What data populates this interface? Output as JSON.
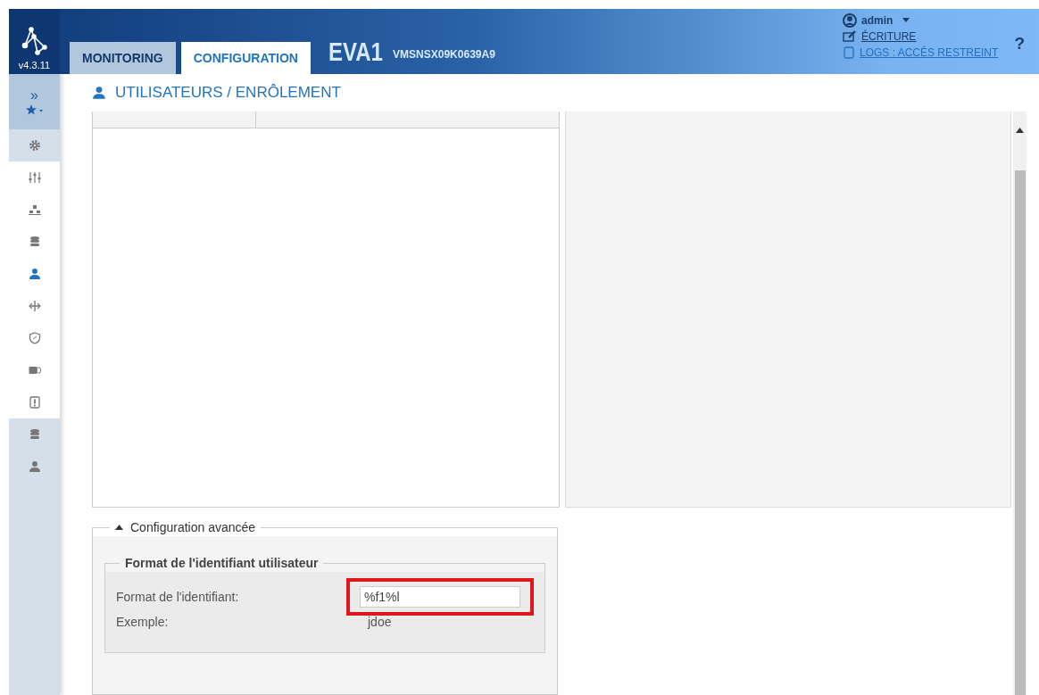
{
  "header": {
    "version": "v4.3.11",
    "device_name": "EVA1",
    "serial": "VMSNSX09K0639A9",
    "user": "admin",
    "mode_link": "ÉCRITURE",
    "logs_link": "LOGS : ACCÉS RESTREINT",
    "help": "?"
  },
  "tabs": [
    {
      "label": "MONITORING",
      "selected": false
    },
    {
      "label": "CONFIGURATION",
      "selected": true
    }
  ],
  "sidebar": {
    "expand": "»",
    "items": [
      {
        "kind": "category",
        "selected": false
      },
      {
        "kind": "subitem",
        "selected": false
      },
      {
        "kind": "subitem",
        "selected": false
      },
      {
        "kind": "subitem",
        "selected": false
      },
      {
        "kind": "subitem",
        "selected": true
      },
      {
        "kind": "subitem",
        "selected": false
      },
      {
        "kind": "subitem",
        "selected": false
      },
      {
        "kind": "subitem",
        "selected": false
      },
      {
        "kind": "subitem",
        "selected": false
      },
      {
        "kind": "category",
        "selected": false
      },
      {
        "kind": "category",
        "selected": false
      }
    ]
  },
  "page_title": "UTILISATEURS / ENRÔLEMENT",
  "advanced": {
    "legend": "Configuration avancée",
    "expanded": true,
    "group_legend": "Format de l'identifiant utilisateur",
    "fields": [
      {
        "kind": "input",
        "label": "Format de l'identifiant:",
        "value": "%f1%l",
        "highlighted": true
      },
      {
        "kind": "text",
        "label": "Exemple:",
        "value": "jdoe"
      }
    ]
  }
}
